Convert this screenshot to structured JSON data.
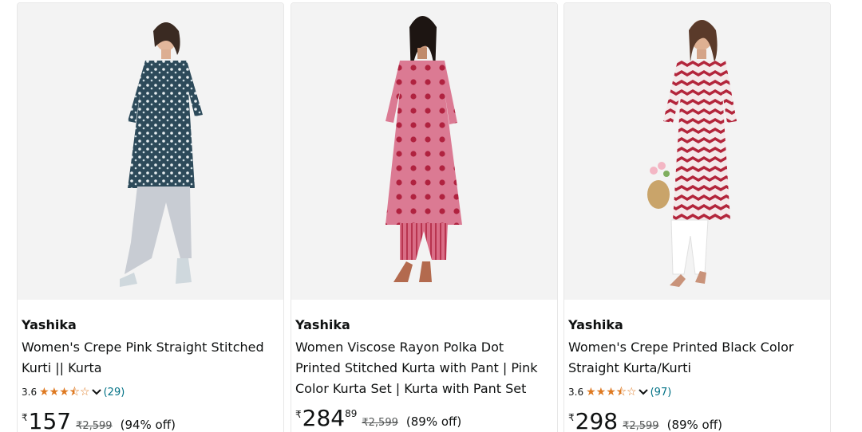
{
  "products": [
    {
      "brand": "Yashika",
      "title": "Women's Crepe Pink Straight Stitched Kurti || Kurta",
      "rating": "3.6",
      "stars": 3.5,
      "review_count": "(29)",
      "currency": "₹",
      "price_whole": "157",
      "price_fraction": "",
      "mrp": "₹2,599",
      "discount": "(94% off)",
      "image_icon": "product-image-kurta-navy-print"
    },
    {
      "brand": "Yashika",
      "title": "Women Viscose Rayon Polka Dot Printed Stitched Kurta with Pant | Pink Color Kurta Set | Kurta with Pant Set for…",
      "currency": "₹",
      "price_whole": "284",
      "price_fraction": "89",
      "mrp": "₹2,599",
      "discount": "(89% off)",
      "image_icon": "product-image-kurta-pink-polka"
    },
    {
      "brand": "Yashika",
      "title": "Women's Crepe Printed Black Color Straight Kurta/Kurti",
      "rating": "3.6",
      "stars": 3.5,
      "review_count": "(97)",
      "currency": "₹",
      "price_whole": "298",
      "price_fraction": "",
      "mrp": "₹2,599",
      "discount": "(89% off)",
      "image_icon": "product-image-kurta-red-chevron"
    }
  ],
  "colors": {
    "star": "#de7921",
    "link": "#007185",
    "image_bg": "#f3f3f3"
  }
}
